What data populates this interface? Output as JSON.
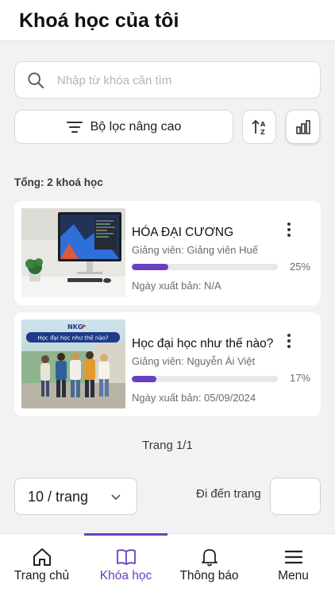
{
  "header": {
    "title": "Khoá học của tôi"
  },
  "search": {
    "placeholder": "Nhập từ khóa cần tìm",
    "value": ""
  },
  "toolbar": {
    "filter_label": "Bộ lọc nâng cao"
  },
  "summary": {
    "total_label": "Tổng: 2 khoá học"
  },
  "courses": [
    {
      "title": "HÓA ĐẠI CƯƠNG",
      "teacher": "Giảng viên: Giảng viên  Huế",
      "progress_percent": 25,
      "progress_label": "25%",
      "publish_date": "Ngày xuất bản: N/A"
    },
    {
      "title": "Học đại học như thế nào?",
      "teacher": "Giảng viên: Nguyễn Ái Việt",
      "progress_percent": 17,
      "progress_label": "17%",
      "publish_date": "Ngày xuất bản: 05/09/2024",
      "thumb_banner": "Học đại học như thế nào?",
      "thumb_logo": "NKG"
    }
  ],
  "pagination": {
    "page_label": "Trang 1/1",
    "per_page_value": "10 / trang",
    "goto_label": "Đi đến trang",
    "goto_value": ""
  },
  "bottom_nav": {
    "items": [
      {
        "label": "Trang chủ",
        "icon": "home-icon"
      },
      {
        "label": "Khóa học",
        "icon": "book-icon",
        "active": true
      },
      {
        "label": "Thông báo",
        "icon": "bell-icon"
      },
      {
        "label": "Menu",
        "icon": "menu-icon"
      }
    ]
  },
  "colors": {
    "accent": "#6a3fc1",
    "background": "#f2f2f4",
    "card": "#ffffff"
  }
}
